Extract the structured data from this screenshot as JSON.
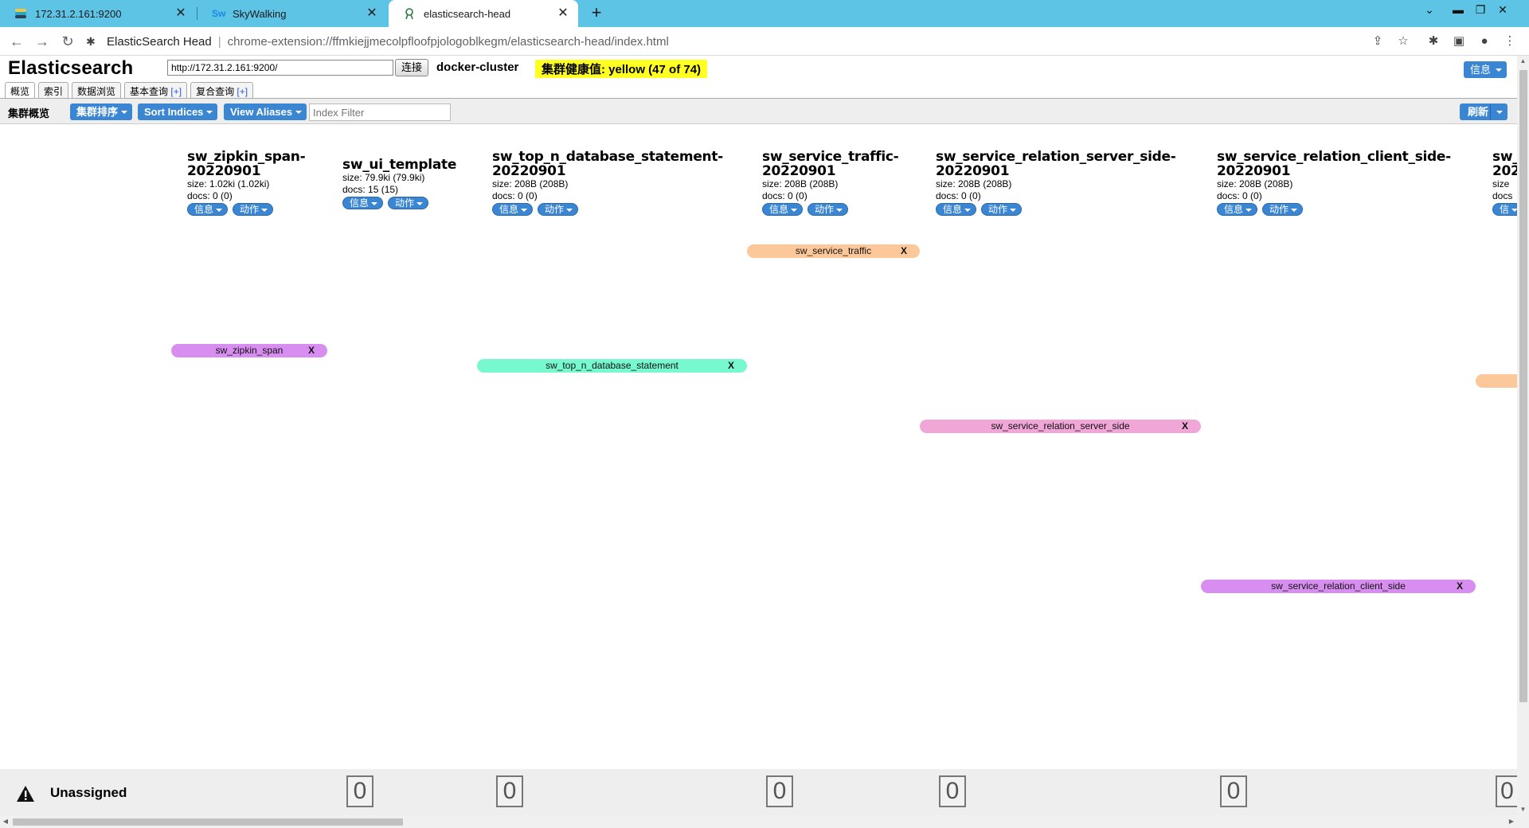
{
  "browser": {
    "tabs": [
      {
        "title": "172.31.2.161:9200",
        "icon": "elastic-favicon"
      },
      {
        "title": "SkyWalking",
        "icon": "skywalking-favicon"
      },
      {
        "title": "elasticsearch-head",
        "icon": "head-favicon"
      }
    ],
    "omnibox_title": "ElasticSearch Head",
    "omnibox_separator": "|",
    "omnibox_url": "chrome-extension://ffmkiejjmecolpfloofpjologoblkegm/elasticsearch-head/index.html"
  },
  "header": {
    "brand": "Elasticsearch",
    "cluster_url": "http://172.31.2.161:9200/",
    "connect_label": "连接",
    "cluster_name": "docker-cluster",
    "health": "集群健康值: yellow (47 of 74)",
    "health_color": "#ffff22",
    "info_label": "信息"
  },
  "es_tabs": [
    {
      "label": "概览",
      "plus": ""
    },
    {
      "label": "索引",
      "plus": ""
    },
    {
      "label": "数据浏览",
      "plus": ""
    },
    {
      "label": "基本查询 ",
      "plus": "[+]"
    },
    {
      "label": "复合查询 ",
      "plus": "[+]"
    }
  ],
  "overview": {
    "title": "集群概览",
    "sort_cluster_label": "集群排序",
    "sort_indices_label": "Sort Indices",
    "view_aliases_label": "View Aliases",
    "filter_placeholder": "Index Filter",
    "refresh_label": "刷新"
  },
  "indices": [
    {
      "name": "sw_zipkin_span-\n20220901",
      "size": "size: 1.02ki (1.02ki)",
      "docs": "docs: 0 (0)",
      "info": "信息",
      "action": "动作"
    },
    {
      "name": "sw_ui_template",
      "size": "size: 79.9ki (79.9ki)",
      "docs": "docs: 15 (15)",
      "info": "信息",
      "action": "动作"
    },
    {
      "name": "sw_top_n_database_statement-\n20220901",
      "size": "size: 208B (208B)",
      "docs": "docs: 0 (0)",
      "info": "信息",
      "action": "动作"
    },
    {
      "name": "sw_service_traffic-\n20220901",
      "size": "size: 208B (208B)",
      "docs": "docs: 0 (0)",
      "info": "信息",
      "action": "动作"
    },
    {
      "name": "sw_service_relation_server_side-\n20220901",
      "size": "size: 208B (208B)",
      "docs": "docs: 0 (0)",
      "info": "信息",
      "action": "动作"
    },
    {
      "name": "sw_service_relation_client_side-\n20220901",
      "size": "size: 208B (208B)",
      "docs": "docs: 0 (0)",
      "info": "信息",
      "action": "动作"
    },
    {
      "name": "sw_\n202",
      "size": "size",
      "docs": "docs",
      "info": "信息",
      "action": ""
    }
  ],
  "aliases": [
    {
      "name": "sw_service_traffic",
      "close": "X",
      "color": "#fcc89a"
    },
    {
      "name": "sw_zipkin_span",
      "close": "X",
      "color": "#d88ef0"
    },
    {
      "name": "sw_top_n_database_statement",
      "close": "X",
      "color": "#77f8ce"
    },
    {
      "name": "",
      "close": "",
      "color": "#fcc89a"
    },
    {
      "name": "sw_service_relation_server_side",
      "close": "X",
      "color": "#f0a6d6"
    },
    {
      "name": "sw_service_relation_client_side",
      "close": "X",
      "color": "#d88ef0"
    }
  ],
  "unassigned": {
    "label": "Unassigned",
    "counts": [
      "0",
      "0",
      "0",
      "0",
      "0",
      "0"
    ]
  }
}
